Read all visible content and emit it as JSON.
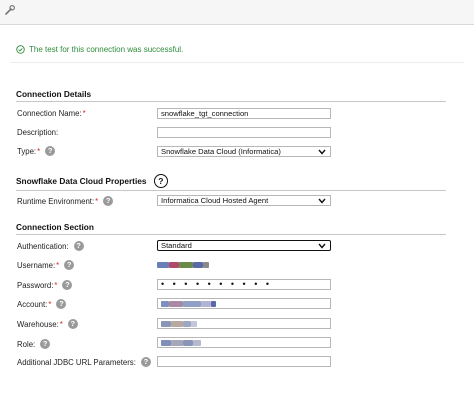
{
  "icons": {
    "wrench": "wrench-icon",
    "success": "check-circle-icon",
    "help": "help-icon",
    "dropdown": "chevron-down-icon"
  },
  "colors": {
    "success": "#2e8b3a",
    "required": "#d12b2b",
    "help": "#9a9a9a"
  },
  "status_message": "The test for this connection was successful.",
  "sections": {
    "connection_details": "Connection Details",
    "properties": "Snowflake Data Cloud Properties",
    "connection_section": "Connection Section"
  },
  "fields": {
    "connection_name": {
      "label": "Connection Name:",
      "value": "snowflake_tgt_connection"
    },
    "description": {
      "label": "Description:",
      "value": ""
    },
    "type": {
      "label": "Type:",
      "value": "Snowflake Data Cloud (Informatica)"
    },
    "runtime_environment": {
      "label": "Runtime Environment:",
      "value": "Informatica Cloud Hosted Agent"
    },
    "authentication": {
      "label": "Authentication:",
      "value": "Standard"
    },
    "username": {
      "label": "Username:"
    },
    "password": {
      "label": "Password:",
      "value": "• • • • • • • • • •"
    },
    "account": {
      "label": "Account:"
    },
    "warehouse": {
      "label": "Warehouse:"
    },
    "role": {
      "label": "Role:"
    },
    "jdbc_params": {
      "label": "Additional JDBC URL Parameters:",
      "value": ""
    }
  },
  "required_marker": "*",
  "help_glyph": "?"
}
